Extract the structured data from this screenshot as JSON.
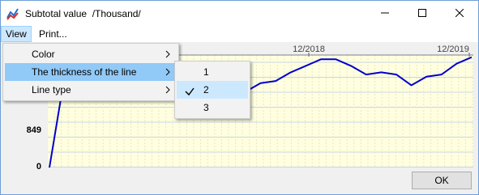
{
  "window": {
    "title": "Subtotal value  /Thousand/"
  },
  "menubar": {
    "view_label": "View",
    "print_label": "Print..."
  },
  "view_menu": {
    "items": [
      {
        "label": "Color"
      },
      {
        "label": "The thickness of the line"
      },
      {
        "label": "Line type"
      }
    ]
  },
  "thickness_submenu": {
    "items": [
      {
        "label": "1"
      },
      {
        "label": "2"
      },
      {
        "label": "3"
      }
    ],
    "checked": "2"
  },
  "chart_data": {
    "type": "line",
    "x_tick_labels": [
      "12/2018",
      "12/2019"
    ],
    "y_tick_labels": [
      "849",
      "0"
    ],
    "series": [
      {
        "values": [
          0,
          2100,
          1950,
          2000,
          1950,
          1900,
          1650,
          1900,
          1950,
          2150,
          2250,
          2200,
          2100,
          1750,
          1950,
          2000,
          2200,
          2350,
          2500,
          2500,
          2350,
          2150,
          2200,
          2150,
          1900,
          2100,
          2150,
          2400,
          2550
        ]
      }
    ],
    "ylim": [
      0,
      2600
    ],
    "grid": true,
    "colors": {
      "line": "#0000cc",
      "grid": "#c9d4e8",
      "background": "#ffffe0"
    }
  },
  "footer": {
    "ok_label": "OK"
  }
}
